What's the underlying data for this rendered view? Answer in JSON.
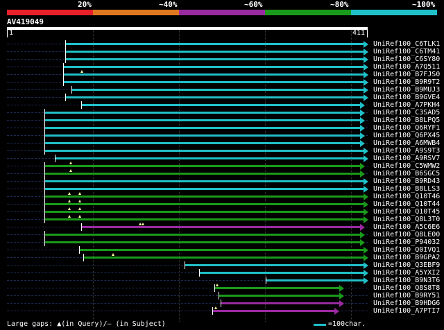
{
  "scale": {
    "labels": [
      "20%",
      "~40%",
      "~60%",
      "~80%",
      "~100%"
    ],
    "colors": [
      "#e8202a",
      "#e07820",
      "#9a2aa0",
      "#1a9a1a",
      "#20c0c8"
    ]
  },
  "query": {
    "id": "AV419049",
    "start": "1",
    "end": "411"
  },
  "hits": [
    {
      "name": "UniRef100_C6TLK1",
      "color": "#20c0c8",
      "s": 0.164,
      "e": 1.0,
      "q": 0.0,
      "gaps": []
    },
    {
      "name": "UniRef100_C6TM41",
      "color": "#20c0c8",
      "s": 0.164,
      "e": 1.0,
      "q": 0.0,
      "gaps": []
    },
    {
      "name": "UniRef100_C6SY80",
      "color": "#20c0c8",
      "s": 0.164,
      "e": 1.0,
      "q": 0.0,
      "gaps": []
    },
    {
      "name": "UniRef100_A7Q511",
      "color": "#20c0c8",
      "s": 0.158,
      "e": 1.0,
      "q": 0.0,
      "gaps": []
    },
    {
      "name": "UniRef100_B7FJS0",
      "color": "#20c0c8",
      "s": 0.158,
      "e": 1.0,
      "q": 0.0,
      "gaps": [
        0.208
      ]
    },
    {
      "name": "UniRef100_B9R9T2",
      "color": "#20c0c8",
      "s": 0.158,
      "e": 1.0,
      "q": 0.0,
      "gaps": []
    },
    {
      "name": "UniRef100_B9MUJ3",
      "color": "#20c0c8",
      "s": 0.18,
      "e": 1.0,
      "q": 0.0,
      "gaps": []
    },
    {
      "name": "UniRef100_B9GVE4",
      "color": "#20c0c8",
      "s": 0.164,
      "e": 1.0,
      "q": 0.0,
      "gaps": []
    },
    {
      "name": "UniRef100_A7PKH4",
      "color": "#20c0c8",
      "s": 0.208,
      "e": 0.99,
      "q": 0.0,
      "gaps": []
    },
    {
      "name": "UniRef100_C3SAD5",
      "color": "#20c0c8",
      "s": 0.106,
      "e": 0.99,
      "q": 0.0,
      "gaps": []
    },
    {
      "name": "UniRef100_B8LPQ5",
      "color": "#20c0c8",
      "s": 0.106,
      "e": 0.99,
      "q": 0.0,
      "gaps": []
    },
    {
      "name": "UniRef100_Q6RYF1",
      "color": "#20c0c8",
      "s": 0.106,
      "e": 0.99,
      "q": 0.0,
      "gaps": []
    },
    {
      "name": "UniRef100_Q6PX45",
      "color": "#20c0c8",
      "s": 0.106,
      "e": 0.99,
      "q": 0.0,
      "gaps": []
    },
    {
      "name": "UniRef100_A6MWB4",
      "color": "#20c0c8",
      "s": 0.106,
      "e": 0.99,
      "q": 0.0,
      "gaps": []
    },
    {
      "name": "UniRef100_A9S9T3",
      "color": "#20c0c8",
      "s": 0.106,
      "e": 1.0,
      "q": 0.0,
      "gaps": []
    },
    {
      "name": "UniRef100_A9RSV7",
      "color": "#20c0c8",
      "s": 0.135,
      "e": 1.0,
      "q": 0.0,
      "gaps": []
    },
    {
      "name": "UniRef100_C5WMW2",
      "color": "#1a9a1a",
      "s": 0.106,
      "e": 0.99,
      "q": 0.0,
      "gaps": [
        0.177
      ]
    },
    {
      "name": "UniRef100_B6SGC5",
      "color": "#1a9a1a",
      "s": 0.106,
      "e": 0.99,
      "q": 0.0,
      "gaps": [
        0.177
      ]
    },
    {
      "name": "UniRef100_B9RD43",
      "color": "#20c0c8",
      "s": 0.106,
      "e": 1.0,
      "q": 0.0,
      "gaps": []
    },
    {
      "name": "UniRef100_B8LLS3",
      "color": "#20c0c8",
      "s": 0.106,
      "e": 1.0,
      "q": 0.0,
      "gaps": []
    },
    {
      "name": "UniRef100_Q10T46",
      "color": "#1a9a1a",
      "s": 0.106,
      "e": 1.0,
      "q": 0.0,
      "gaps": [
        0.173,
        0.202
      ]
    },
    {
      "name": "UniRef100_Q10T44",
      "color": "#1a9a1a",
      "s": 0.106,
      "e": 1.0,
      "q": 0.0,
      "gaps": [
        0.173,
        0.202
      ]
    },
    {
      "name": "UniRef100_Q10T45",
      "color": "#1a9a1a",
      "s": 0.106,
      "e": 1.0,
      "q": 0.0,
      "gaps": [
        0.173,
        0.202
      ]
    },
    {
      "name": "UniRef100_Q8L3T0",
      "color": "#1a9a1a",
      "s": 0.106,
      "e": 1.0,
      "q": 0.0,
      "gaps": [
        0.173,
        0.202
      ]
    },
    {
      "name": "UniRef100_A5C6E6",
      "color": "#9a2aa0",
      "s": 0.208,
      "e": 0.99,
      "q": 0.0,
      "gaps": [
        0.369,
        0.377
      ]
    },
    {
      "name": "UniRef100_Q8LE00",
      "color": "#1a9a1a",
      "s": 0.106,
      "e": 0.99,
      "q": 0.0,
      "gaps": []
    },
    {
      "name": "UniRef100_P94032",
      "color": "#1a9a1a",
      "s": 0.106,
      "e": 0.99,
      "q": 0.0,
      "gaps": []
    },
    {
      "name": "UniRef100_Q0IVQ1",
      "color": "#1a9a1a",
      "s": 0.202,
      "e": 1.0,
      "q": 0.0,
      "gaps": []
    },
    {
      "name": "UniRef100_B9GPA2",
      "color": "#1a9a1a",
      "s": 0.213,
      "e": 1.0,
      "q": 0.0,
      "gaps": [
        0.294
      ]
    },
    {
      "name": "UniRef100_Q3EBF9",
      "color": "#20c0c8",
      "s": 0.494,
      "e": 1.0,
      "q": 0.0,
      "gaps": []
    },
    {
      "name": "UniRef100_A5YXI2",
      "color": "#20c0c8",
      "s": 0.535,
      "e": 1.0,
      "q": 0.0,
      "gaps": []
    },
    {
      "name": "UniRef100_B9N3T6",
      "color": "#20c0c8",
      "s": 0.719,
      "e": 1.0,
      "q": 0.0,
      "gaps": []
    },
    {
      "name": "UniRef100_Q8S8T8",
      "color": "#1a9a1a",
      "s": 0.577,
      "e": 0.933,
      "q": 0.0,
      "gaps": [
        0.583
      ]
    },
    {
      "name": "UniRef100_B9RY51",
      "color": "#1a9a1a",
      "s": 0.588,
      "e": 0.933,
      "q": 0.0,
      "gaps": []
    },
    {
      "name": "UniRef100_B9HDG6",
      "color": "#9a2aa0",
      "s": 0.594,
      "e": 0.933,
      "q": 0.0,
      "gaps": []
    },
    {
      "name": "UniRef100_A7PTI7",
      "color": "#9a2aa0",
      "s": 0.571,
      "e": 0.92,
      "q": 0.0,
      "gaps": [
        0.579
      ]
    }
  ],
  "legend": {
    "gaps_text": "Large gaps: ▲(in Query)/— (in Subject)",
    "scale_text": "=100char.",
    "scale_color": "#20c0c8"
  }
}
